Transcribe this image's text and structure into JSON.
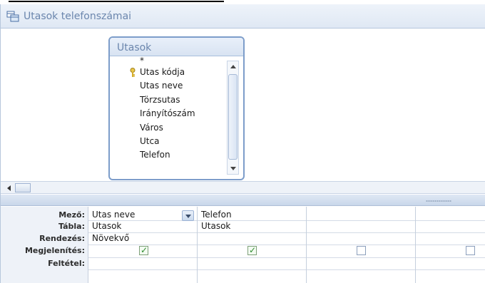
{
  "window": {
    "title": "Utasok telefonszámai"
  },
  "table_box": {
    "name": "Utasok",
    "fields": [
      {
        "label": "*",
        "key": false
      },
      {
        "label": "Utas kódja",
        "key": true
      },
      {
        "label": "Utas neve",
        "key": false
      },
      {
        "label": "Törzsutas",
        "key": false
      },
      {
        "label": "Irányítószám",
        "key": false
      },
      {
        "label": "Város",
        "key": false
      },
      {
        "label": "Utca",
        "key": false
      },
      {
        "label": "Telefon",
        "key": false
      }
    ]
  },
  "grid": {
    "row_labels": {
      "field": "Mező:",
      "table": "Tábla:",
      "sort": "Rendezés:",
      "show": "Megjelenítés:",
      "criteria": "Feltétel:"
    },
    "columns": [
      {
        "field": "Utas neve",
        "table": "Utasok",
        "sort": "Növekvő",
        "show": true
      },
      {
        "field": "Telefon",
        "table": "Utasok",
        "sort": "",
        "show": true
      },
      {
        "field": "",
        "table": "",
        "sort": "",
        "show": false
      },
      {
        "field": "",
        "table": "",
        "sort": "",
        "show": false
      }
    ]
  },
  "colors": {
    "accent": "#6b86ad",
    "border": "#7d9dca",
    "check": "#2e8b2e"
  },
  "icons": {
    "title": "query-icon",
    "key": "primary-key-icon"
  }
}
